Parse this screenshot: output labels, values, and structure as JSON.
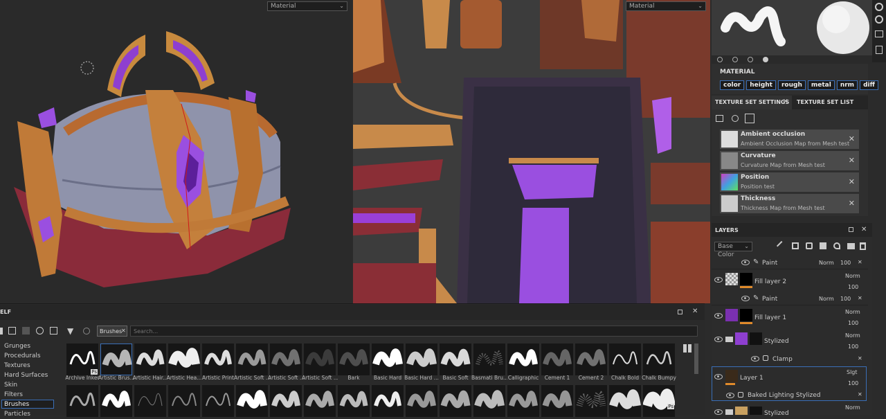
{
  "viewport3d": {
    "dropdown": "Material"
  },
  "viewport2d": {
    "dropdown": "Material"
  },
  "material": {
    "title": "MATERIAL",
    "channels": [
      "color",
      "height",
      "rough",
      "metal",
      "nrm",
      "diff"
    ]
  },
  "texture_set": {
    "tab_settings": "TEXTURE SET SETTINGS",
    "tab_close": "✕",
    "tab_list": "TEXTURE SET LIST",
    "maps": [
      {
        "title": "Ambient occlusion",
        "sub": "Ambient Occlusion Map from Mesh test"
      },
      {
        "title": "Curvature",
        "sub": "Curvature Map from Mesh test"
      },
      {
        "title": "Position",
        "sub": "Position test"
      },
      {
        "title": "Thickness",
        "sub": "Thickness Map from Mesh test"
      }
    ],
    "remove": "✕"
  },
  "layers": {
    "title": "LAYERS",
    "channel": "Base Color",
    "rows": [
      {
        "name": "Paint",
        "blend": "Norm",
        "opacity": "100"
      },
      {
        "name": "Fill layer 2",
        "blend": "Norm",
        "opacity": "100"
      },
      {
        "name": "Paint",
        "blend": "Norm",
        "opacity": "100"
      },
      {
        "name": "Fill layer 1",
        "blend": "Norm",
        "opacity": "100"
      },
      {
        "name": "Stylized",
        "blend": "Norm",
        "opacity": "100"
      },
      {
        "name": "Clamp"
      },
      {
        "name": "Layer 1",
        "blend": "Slgt",
        "opacity": "100"
      },
      {
        "name": "Baked Lighting Stylized"
      },
      {
        "name": "Stylized",
        "blend": "Norm"
      }
    ]
  },
  "shelf": {
    "title": "ELF",
    "filter_tag": "Brushes",
    "search_placeholder": "Search...",
    "categories": [
      "Grunges",
      "Procedurals",
      "Textures",
      "Hard Surfaces",
      "Skin",
      "Filters",
      "Brushes",
      "Particles"
    ],
    "brushes": [
      "Archive Inker",
      "Artistic Brus...",
      "Artistic Hair...",
      "Artistic Hea...",
      "Artistic Print",
      "Artistic Soft ...",
      "Artistic Soft ...",
      "Artistic Soft ...",
      "Bark",
      "Basic Hard",
      "Basic Hard ...",
      "Basic Soft",
      "Basmati Bru...",
      "Calligraphic",
      "Cement 1",
      "Cement 2",
      "Chalk Bold",
      "Chalk Bumpy"
    ],
    "badge": "Ps"
  },
  "colors": {
    "accent": "#3a6fb8",
    "purple": "#8e3fd0",
    "orange": "#e08a2a"
  }
}
